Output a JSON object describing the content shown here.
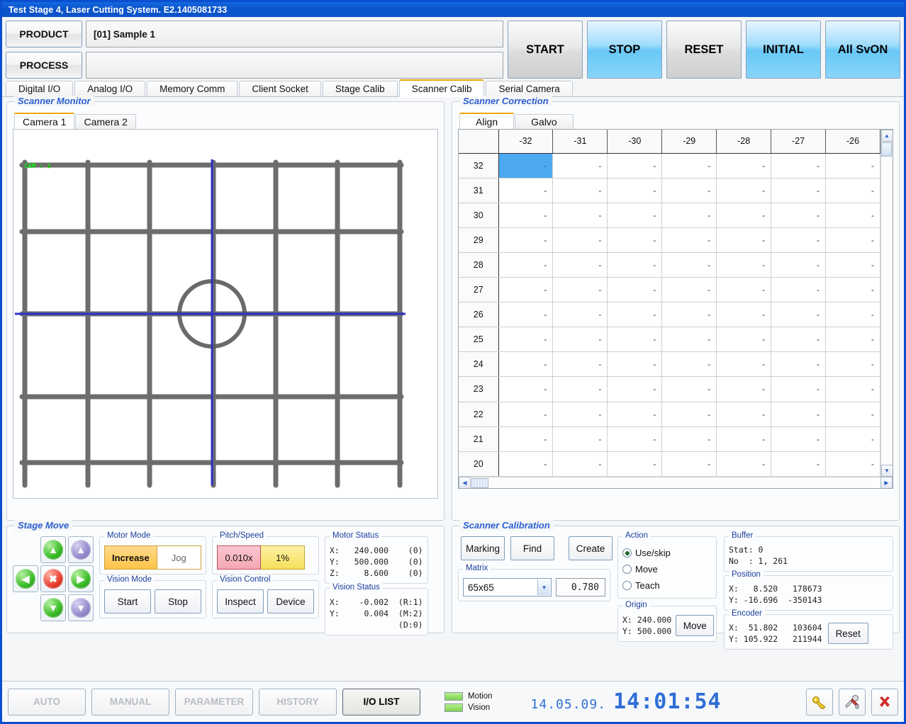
{
  "window": {
    "title": "Test Stage 4, Laser Cutting System. E2.1405081733"
  },
  "header": {
    "product_label": "PRODUCT",
    "product_value": "[01] Sample 1",
    "process_label": "PROCESS",
    "process_value": "",
    "buttons": [
      {
        "label": "START",
        "style": "gray"
      },
      {
        "label": "STOP",
        "style": "blue"
      },
      {
        "label": "RESET",
        "style": "gray"
      },
      {
        "label": "INITIAL",
        "style": "blue"
      },
      {
        "label": "All SvON",
        "style": "blue"
      }
    ]
  },
  "tabs": [
    {
      "label": "Digital I/O",
      "active": false
    },
    {
      "label": "Analog I/O",
      "active": false
    },
    {
      "label": "Memory Comm",
      "active": false
    },
    {
      "label": "Client Socket",
      "active": false
    },
    {
      "label": "Stage Calib",
      "active": false
    },
    {
      "label": "Scanner Calib",
      "active": true
    },
    {
      "label": "Serial Camera",
      "active": false
    }
  ],
  "scanner_monitor": {
    "title": "Scanner Monitor",
    "camera_tabs": [
      {
        "label": "Camera 1",
        "active": true
      },
      {
        "label": "Camera 2",
        "active": false
      }
    ],
    "overlay_label": "CAM : 1"
  },
  "scanner_correction": {
    "title": "Scanner Correction",
    "tabs": [
      {
        "label": "Align",
        "active": true
      },
      {
        "label": "Galvo",
        "active": false
      }
    ],
    "columns": [
      "-32",
      "-31",
      "-30",
      "-29",
      "-28",
      "-27",
      "-26"
    ],
    "rows": [
      "32",
      "31",
      "30",
      "29",
      "28",
      "27",
      "26",
      "25",
      "24",
      "23",
      "22",
      "21",
      "20"
    ],
    "empty_cell": "-",
    "selected": {
      "row": "32",
      "col": "-32"
    }
  },
  "stage_move": {
    "title": "Stage Move",
    "dpad": [
      {
        "name": "y-plus",
        "icon": "▲",
        "color": "green"
      },
      {
        "name": "z-plus",
        "icon": "▲",
        "color": "purple"
      },
      {
        "name": "x-minus",
        "icon": "◀",
        "color": "green"
      },
      {
        "name": "stop",
        "icon": "✖",
        "color": "red"
      },
      {
        "name": "x-plus",
        "icon": "▶",
        "color": "green"
      },
      {
        "name": "y-minus",
        "icon": "▼",
        "color": "green"
      },
      {
        "name": "z-minus",
        "icon": "▼",
        "color": "purple"
      }
    ],
    "motor_mode": {
      "label": "Motor Mode",
      "active": "Increase",
      "inactive": "Jog"
    },
    "pitch_speed": {
      "label": "Pitch/Speed",
      "pitch": "0.010x",
      "speed": "1%"
    },
    "motor_status": {
      "label": "Motor Status",
      "lines": [
        "X:   240.000    (0)",
        "Y:   500.000    (0)",
        "Z:     8.600    (0)"
      ]
    },
    "vision_mode": {
      "label": "Vision Mode",
      "start": "Start",
      "stop": "Stop"
    },
    "vision_control": {
      "label": "Vision Control",
      "inspect": "Inspect",
      "device": "Device"
    },
    "vision_status": {
      "label": "Vision Status",
      "lines": [
        "X:    -0.002  (R:1)",
        "Y:     0.004  (M:2)",
        "              (D:0)"
      ]
    }
  },
  "scanner_calibration": {
    "title": "Scanner Calibration",
    "buttons": [
      "Marking",
      "Find",
      "Create"
    ],
    "matrix": {
      "label": "Matrix",
      "value": "65x65",
      "scale": "0.780"
    },
    "action": {
      "label": "Action",
      "options": [
        {
          "label": "Use/skip",
          "selected": true
        },
        {
          "label": "Move",
          "selected": false
        },
        {
          "label": "Teach",
          "selected": false
        }
      ]
    },
    "origin": {
      "label": "Origin",
      "lines": [
        "X: 240.000",
        "Y: 500.000"
      ],
      "button": "Move"
    },
    "buffer": {
      "label": "Buffer",
      "lines": [
        "Stat: 0",
        "No  : 1, 261"
      ]
    },
    "position": {
      "label": "Position",
      "lines": [
        "X:   8.520   178673",
        "Y: -16.696  -350143"
      ]
    },
    "encoder": {
      "label": "Encoder",
      "lines": [
        "X:  51.802   103604",
        "Y: 105.922   211944"
      ],
      "button": "Reset"
    }
  },
  "statusbar": {
    "modes": [
      {
        "label": "AUTO",
        "active": false
      },
      {
        "label": "MANUAL",
        "active": false
      },
      {
        "label": "PARAMETER",
        "active": false
      },
      {
        "label": "HISTORY",
        "active": false
      },
      {
        "label": "I/O LIST",
        "active": true
      }
    ],
    "leds": [
      {
        "label": "Motion",
        "color": "#7fd050"
      },
      {
        "label": "Vision",
        "color": "#7fd050"
      }
    ],
    "date": "14.05.09.",
    "time": "14:01:54",
    "icons": [
      "key-icon",
      "tools-icon",
      "close-icon"
    ]
  },
  "colors": {
    "titlebar": "#0a53c8",
    "accent_tab": "#f0a500",
    "selection": "#4daaf0",
    "group_label": "#2b5fd0",
    "lcd": "#2f6fd6"
  }
}
